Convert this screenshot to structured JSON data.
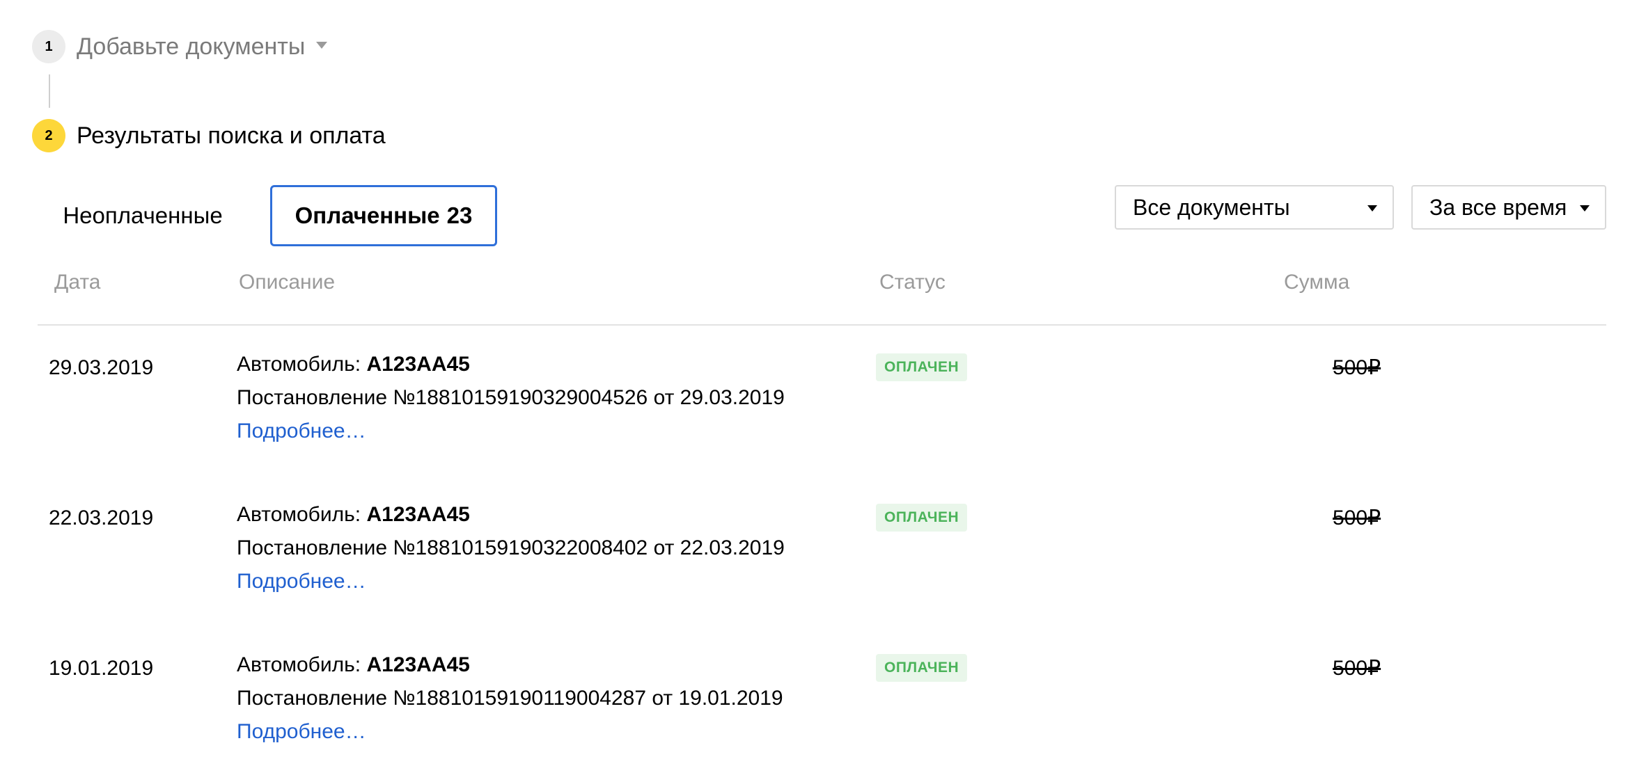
{
  "steps": [
    {
      "number": "1",
      "label": "Добавьте документы"
    },
    {
      "number": "2",
      "label": "Результаты поиска и оплата"
    }
  ],
  "colors": {
    "active_step": "#fdd73a",
    "tab_border": "#2f6fd9",
    "status_text": "#4bb35a",
    "status_bg": "#e9f6ea",
    "link": "#1f5fcf"
  },
  "tabs": {
    "unpaid_label": "Неоплаченные",
    "paid_label": "Оплаченные",
    "paid_count": "23",
    "active": "paid"
  },
  "filters": {
    "documents": {
      "selected": "Все документы",
      "icon": "caret-down-icon"
    },
    "period": {
      "selected": "За все время",
      "icon": "caret-down-icon"
    }
  },
  "table": {
    "headers": {
      "date": "Дата",
      "description": "Описание",
      "status": "Статус",
      "amount": "Сумма"
    },
    "rows": [
      {
        "date": "29.03.2019",
        "vehicle_label": "Автомобиль:",
        "plate": "А123АА45",
        "decree": "Постановление №18810159190329004526 от 29.03.2019",
        "more": "Подробнее…",
        "status": "ОПЛАЧЕН",
        "amount": "500₽"
      },
      {
        "date": "22.03.2019",
        "vehicle_label": "Автомобиль:",
        "plate": "А123АА45",
        "decree": "Постановление №18810159190322008402 от 22.03.2019",
        "more": "Подробнее…",
        "status": "ОПЛАЧЕН",
        "amount": "500₽"
      },
      {
        "date": "19.01.2019",
        "vehicle_label": "Автомобиль:",
        "plate": "А123АА45",
        "decree": "Постановление №18810159190119004287 от 19.01.2019",
        "more": "Подробнее…",
        "status": "ОПЛАЧЕН",
        "amount": "500₽"
      }
    ]
  }
}
